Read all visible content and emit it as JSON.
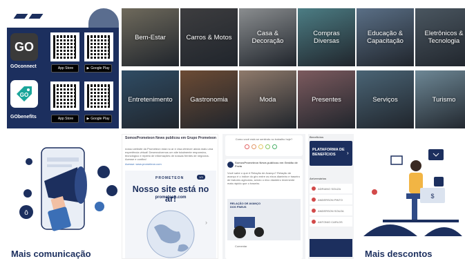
{
  "apps": [
    {
      "icon_text": "GO",
      "label": "GOconnect",
      "icon_bg": "#3a3a3a",
      "icon_fg": "#ffffff"
    },
    {
      "icon_text": "GO",
      "label": "GObenefits",
      "icon_bg": "#1aa59a",
      "icon_fg": "#ffffff"
    }
  ],
  "stores": {
    "apple": "App Store",
    "google": "Google Play"
  },
  "categories": [
    {
      "label": "Bem-Estar",
      "color": "#6f6a5c"
    },
    {
      "label": "Carros & Motos",
      "color": "#3d3d3f"
    },
    {
      "label": "Casa & Decoração",
      "color": "#8a8d8f"
    },
    {
      "label": "Compras Diversas",
      "color": "#4c7d84"
    },
    {
      "label": "Educação & Capacitação",
      "color": "#5a6f86"
    },
    {
      "label": "Eletrônicos & Tecnologia",
      "color": "#4a5660"
    },
    {
      "label": "Entretenimento",
      "color": "#2f4c64"
    },
    {
      "label": "Gastronomia",
      "color": "#6c4b34"
    },
    {
      "label": "Moda",
      "color": "#8f7a6b"
    },
    {
      "label": "Presentes",
      "color": "#7c5a5e"
    },
    {
      "label": "Serviços",
      "color": "#4a6475"
    },
    {
      "label": "Turismo",
      "color": "#6d8795"
    }
  ],
  "card1": {
    "title": "Mais comunicação"
  },
  "card2": {
    "header": "SomosPrometeon News publicou em Grupo Prometeon",
    "body": "nosso website da Prometeon está no ar e visa oferecer ainda mais uma experiência virtual! Desenvolvemos um site totalmente responsivo, tecnológico e repleto de informações de nossas frentes de negócios. Acesse e confira!",
    "link": "Acesse: www.prometeon.com",
    "brand": "PROMETEON",
    "counter": "1/3",
    "headline": "Nosso site está no ar!",
    "url": "prometeon.com"
  },
  "card3": {
    "question": "Como você está se sentindo no trabalho hoje?",
    "poster": "SomosPrometeon News publicou em Gestão de Frota",
    "body": "Você sabe o que é Relação de Avanço? Relação de avanço é o índice do giro entre os eixos dianteiro e traseiro de tratores agrícolas, sendo o eixo dianteiro levemente mais rápido que o traseiro.",
    "banner": "RELAÇÃO DE AVANÇO DOS PNEUS",
    "comment": "Comentar"
  },
  "card4": {
    "section": "Benefícios",
    "banner": "PLATAFORMA DE BENEFÍCIOS",
    "list_title": "Aniversários",
    "items": [
      "ADRIANO SOUZA",
      "ANDERSON PINTO",
      "ANDERSON SOUZA",
      "ANTONIO CARLOS"
    ]
  },
  "card5": {
    "title": "Mais descontos"
  }
}
